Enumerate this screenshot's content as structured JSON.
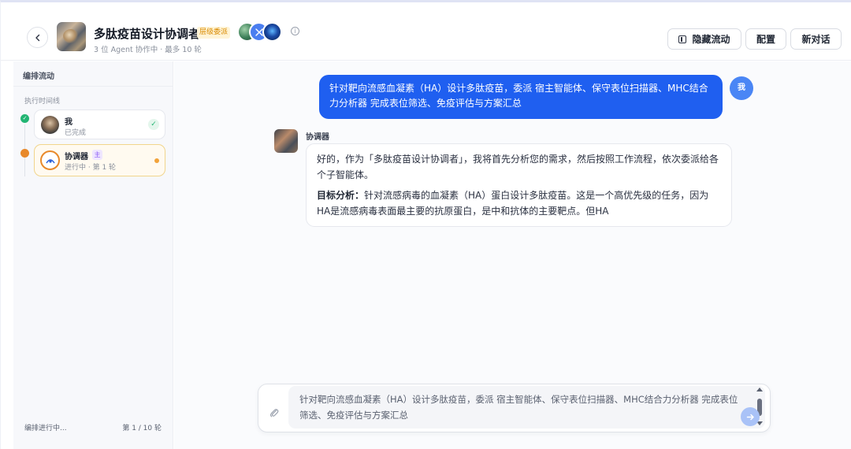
{
  "header": {
    "title": "多肽疫苗设计协调者",
    "tag": "层级委派",
    "subtitle": "3 位 Agent 协作中 · 最多 10 轮",
    "info_symbol": "i",
    "buttons": {
      "hide_flow": "隐藏流动",
      "config": "配置",
      "new_chat": "新对话"
    }
  },
  "sidebar": {
    "title": "编排流动",
    "section": "执行时间线",
    "items": [
      {
        "name": "我",
        "status": "已完成",
        "state": "done",
        "check": "✓"
      },
      {
        "name": "协调器",
        "badge": "主",
        "status": "进行中 · 第 1 轮",
        "state": "active"
      }
    ],
    "footer_left": "编排进行中...",
    "footer_right": "第 1 / 10 轮"
  },
  "chat": {
    "user_message": "针对靶向流感血凝素（HA）设计多肽疫苗，委派 宿主智能体、保守表位扫描器、MHC结合力分析器 完成表位筛选、免疫评估与方案汇总",
    "user_avatar_label": "我",
    "bot_name": "协调器",
    "bot_paragraph_1": "好的，作为「多肽疫苗设计协调者」，我将首先分析您的需求，然后按照工作流程，依次委派给各个子智能体。",
    "bot_lead": "目标分析：",
    "bot_paragraph_2": "针对流感病毒的血凝素（HA）蛋白设计多肽疫苗。这是一个高优先级的任务，因为HA是流感病毒表面最主要的抗原蛋白，是中和抗体的主要靶点。但HA"
  },
  "composer": {
    "value": "针对靶向流感血凝素（HA）设计多肽疫苗，委派 宿主智能体、保守表位扫描器、MHC结合力分析器 完成表位筛选、免疫评估与方案汇总"
  },
  "colors": {
    "primary": "#1f5ff0",
    "success": "#22b573",
    "active": "#e8892a",
    "tag_bg": "#fff4d6",
    "tag_text": "#d98a00"
  },
  "icons": [
    "back-arrow-icon",
    "info-icon",
    "panel-icon",
    "check-icon",
    "attachment-icon",
    "send-icon",
    "scroll-up-icon",
    "scroll-down-icon"
  ]
}
